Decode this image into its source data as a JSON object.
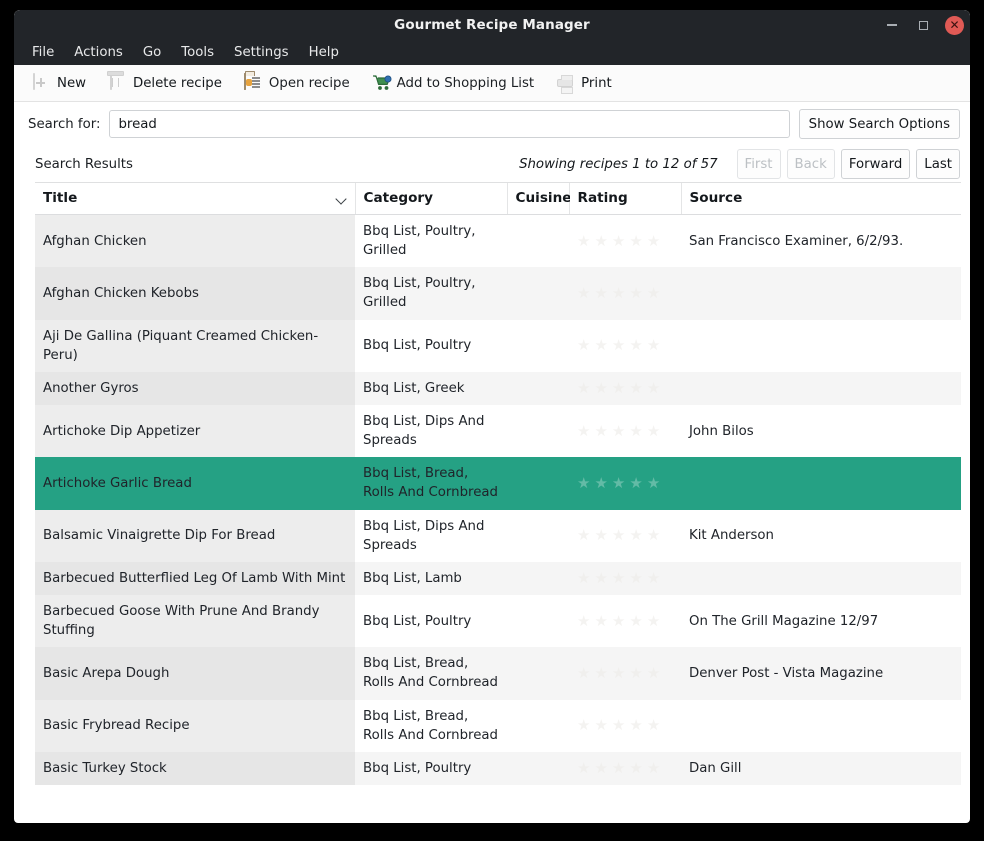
{
  "window": {
    "title": "Gourmet Recipe Manager",
    "buttons": {
      "minimize": "minimize-button",
      "maximize": "maximize-button",
      "close": "✕"
    }
  },
  "menubar": {
    "items": [
      "File",
      "Actions",
      "Go",
      "Tools",
      "Settings",
      "Help"
    ]
  },
  "toolbar": {
    "items": [
      {
        "label": "New",
        "icon": "new-document-icon",
        "enabled": false
      },
      {
        "label": "Delete recipe",
        "icon": "trash-icon",
        "enabled": false
      },
      {
        "label": "Open recipe",
        "icon": "open-folder-icon",
        "enabled": true
      },
      {
        "label": "Add to Shopping List",
        "icon": "shopping-cart-icon",
        "enabled": true
      },
      {
        "label": "Print",
        "icon": "printer-icon",
        "enabled": false
      }
    ]
  },
  "search": {
    "label": "Search for:",
    "value": "bread",
    "placeholder": "",
    "options_button": "Show Search Options"
  },
  "results": {
    "label": "Search Results",
    "showing": "Showing recipes 1 to 12 of 57",
    "pagination": [
      {
        "label": "First",
        "enabled": false
      },
      {
        "label": "Back",
        "enabled": false
      },
      {
        "label": "Forward",
        "enabled": true
      },
      {
        "label": "Last",
        "enabled": true
      }
    ]
  },
  "table": {
    "columns": [
      "Title",
      "Category",
      "Cuisine",
      "Rating",
      "Source"
    ],
    "sorted_column": "Title",
    "sort_icon": "chevron-down-icon",
    "selection_color": "#25a184",
    "rows": [
      {
        "title": "Afghan Chicken",
        "category": "Bbq List, Poultry, Grilled",
        "cuisine": "",
        "rating": 0,
        "source": "San Francisco Examiner, 6/2/93.",
        "selected": false
      },
      {
        "title": "Afghan Chicken Kebobs",
        "category": "Bbq List, Poultry, Grilled",
        "cuisine": "",
        "rating": 0,
        "source": "",
        "selected": false
      },
      {
        "title": "Aji De Gallina (Piquant Creamed Chicken- Peru)",
        "category": "Bbq List, Poultry",
        "cuisine": "",
        "rating": 0,
        "source": "",
        "selected": false
      },
      {
        "title": "Another Gyros",
        "category": "Bbq List, Greek",
        "cuisine": "",
        "rating": 0,
        "source": "",
        "selected": false
      },
      {
        "title": "Artichoke Dip Appetizer",
        "category": "Bbq List, Dips And Spreads",
        "cuisine": "",
        "rating": 0,
        "source": "John Bilos",
        "selected": false
      },
      {
        "title": "Artichoke Garlic Bread",
        "category": "Bbq List, Bread, Rolls And Cornbread",
        "cuisine": "",
        "rating": 0,
        "source": "",
        "selected": true
      },
      {
        "title": "Balsamic Vinaigrette Dip For Bread",
        "category": "Bbq List, Dips And Spreads",
        "cuisine": "",
        "rating": 0,
        "source": "Kit Anderson",
        "selected": false
      },
      {
        "title": "Barbecued Butterflied Leg Of Lamb With Mint",
        "category": "Bbq List, Lamb",
        "cuisine": "",
        "rating": 0,
        "source": "",
        "selected": false
      },
      {
        "title": "Barbecued Goose With Prune And Brandy Stuffing",
        "category": "Bbq List, Poultry",
        "cuisine": "",
        "rating": 0,
        "source": "On The Grill Magazine 12/97",
        "selected": false
      },
      {
        "title": "Basic Arepa Dough",
        "category": "Bbq List, Bread, Rolls And Cornbread",
        "cuisine": "",
        "rating": 0,
        "source": "Denver Post - Vista Magazine",
        "selected": false
      },
      {
        "title": "Basic Frybread Recipe",
        "category": "Bbq List, Bread, Rolls And Cornbread",
        "cuisine": "",
        "rating": 0,
        "source": "",
        "selected": false
      },
      {
        "title": "Basic Turkey Stock",
        "category": "Bbq List, Poultry",
        "cuisine": "",
        "rating": 0,
        "source": "Dan Gill",
        "selected": false
      }
    ]
  }
}
